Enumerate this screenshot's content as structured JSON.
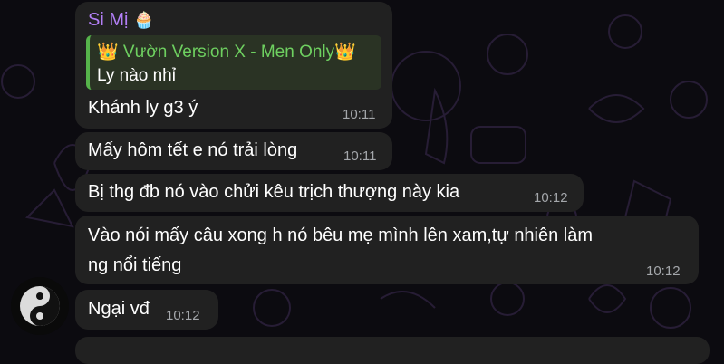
{
  "chat": {
    "sender_name": "Si Mị",
    "sender_emoji": "🧁",
    "reply_title": "👑 Vườn Version X - Men Only👑",
    "reply_text": "Ly nào nhỉ",
    "messages": [
      {
        "text": "Khánh ly g3 ý",
        "time": "10:11"
      },
      {
        "text": "Mấy hôm tết e nó trải lòng",
        "time": "10:11"
      },
      {
        "text": "Bị thg đb nó vào chửi kêu trịch thượng này kia",
        "time": "10:12"
      },
      {
        "text_line1": "Vào nói mấy câu xong h nó bêu mẹ mình lên xam,tự nhiên làm",
        "text_line2": "ng nổi tiếng",
        "time": "10:12"
      },
      {
        "text": "Ngại vđ",
        "time": "10:12"
      }
    ]
  },
  "colors": {
    "background": "#0c0b10",
    "bubble": "#212121",
    "sender_name": "#b37ff7",
    "reply_accent": "#56b34b",
    "timestamp": "#a4a7ab"
  },
  "avatar": {
    "icon": "yin-yang-icon"
  }
}
